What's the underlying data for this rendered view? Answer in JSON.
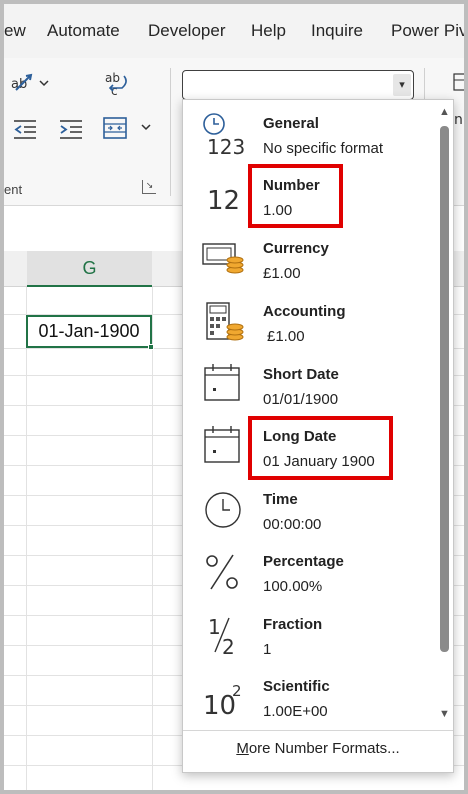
{
  "menu": {
    "items": [
      "ew",
      "Automate",
      "Developer",
      "Help",
      "Inquire",
      "Power Piv"
    ]
  },
  "ribbon": {
    "group_label": "ent",
    "number_format_value": ""
  },
  "sheet": {
    "column_header": "G",
    "active_cell_value": "01-Jan-1900"
  },
  "number_format_menu": {
    "items": [
      {
        "name": "General",
        "sample": "No specific format",
        "icon": "clock-123-icon",
        "highlighted": false
      },
      {
        "name": "Number",
        "sample": "1.00",
        "icon": "number-12-icon",
        "highlighted": true
      },
      {
        "name": "Currency",
        "sample": "£1.00",
        "icon": "currency-icon",
        "highlighted": false
      },
      {
        "name": "Accounting",
        "sample": "£1.00",
        "icon": "accounting-calculator-icon",
        "highlighted": false
      },
      {
        "name": "Short Date",
        "sample": "01/01/1900",
        "icon": "short-date-calendar-icon",
        "highlighted": false
      },
      {
        "name": "Long Date",
        "sample": "01 January 1900",
        "icon": "long-date-calendar-icon",
        "highlighted": true
      },
      {
        "name": "Time",
        "sample": "00:00:00",
        "icon": "time-clock-icon",
        "highlighted": false
      },
      {
        "name": "Percentage",
        "sample": "100.00%",
        "icon": "percent-icon",
        "highlighted": false
      },
      {
        "name": "Fraction",
        "sample": "1",
        "icon": "fraction-half-icon",
        "highlighted": false
      },
      {
        "name": "Scientific",
        "sample": "1.00E+00",
        "icon": "scientific-10-squared-icon",
        "highlighted": false
      }
    ],
    "more_formats_label": "More Number Formats...",
    "icon_text": {
      "general": "123",
      "number": "12",
      "fraction_num": "1",
      "fraction_den": "2",
      "sci_base": "10",
      "sci_exp": "2"
    }
  },
  "colors": {
    "excel_green": "#217346",
    "highlight_red": "#e00000",
    "ribbon_icon_blue": "#2d5f9a"
  }
}
